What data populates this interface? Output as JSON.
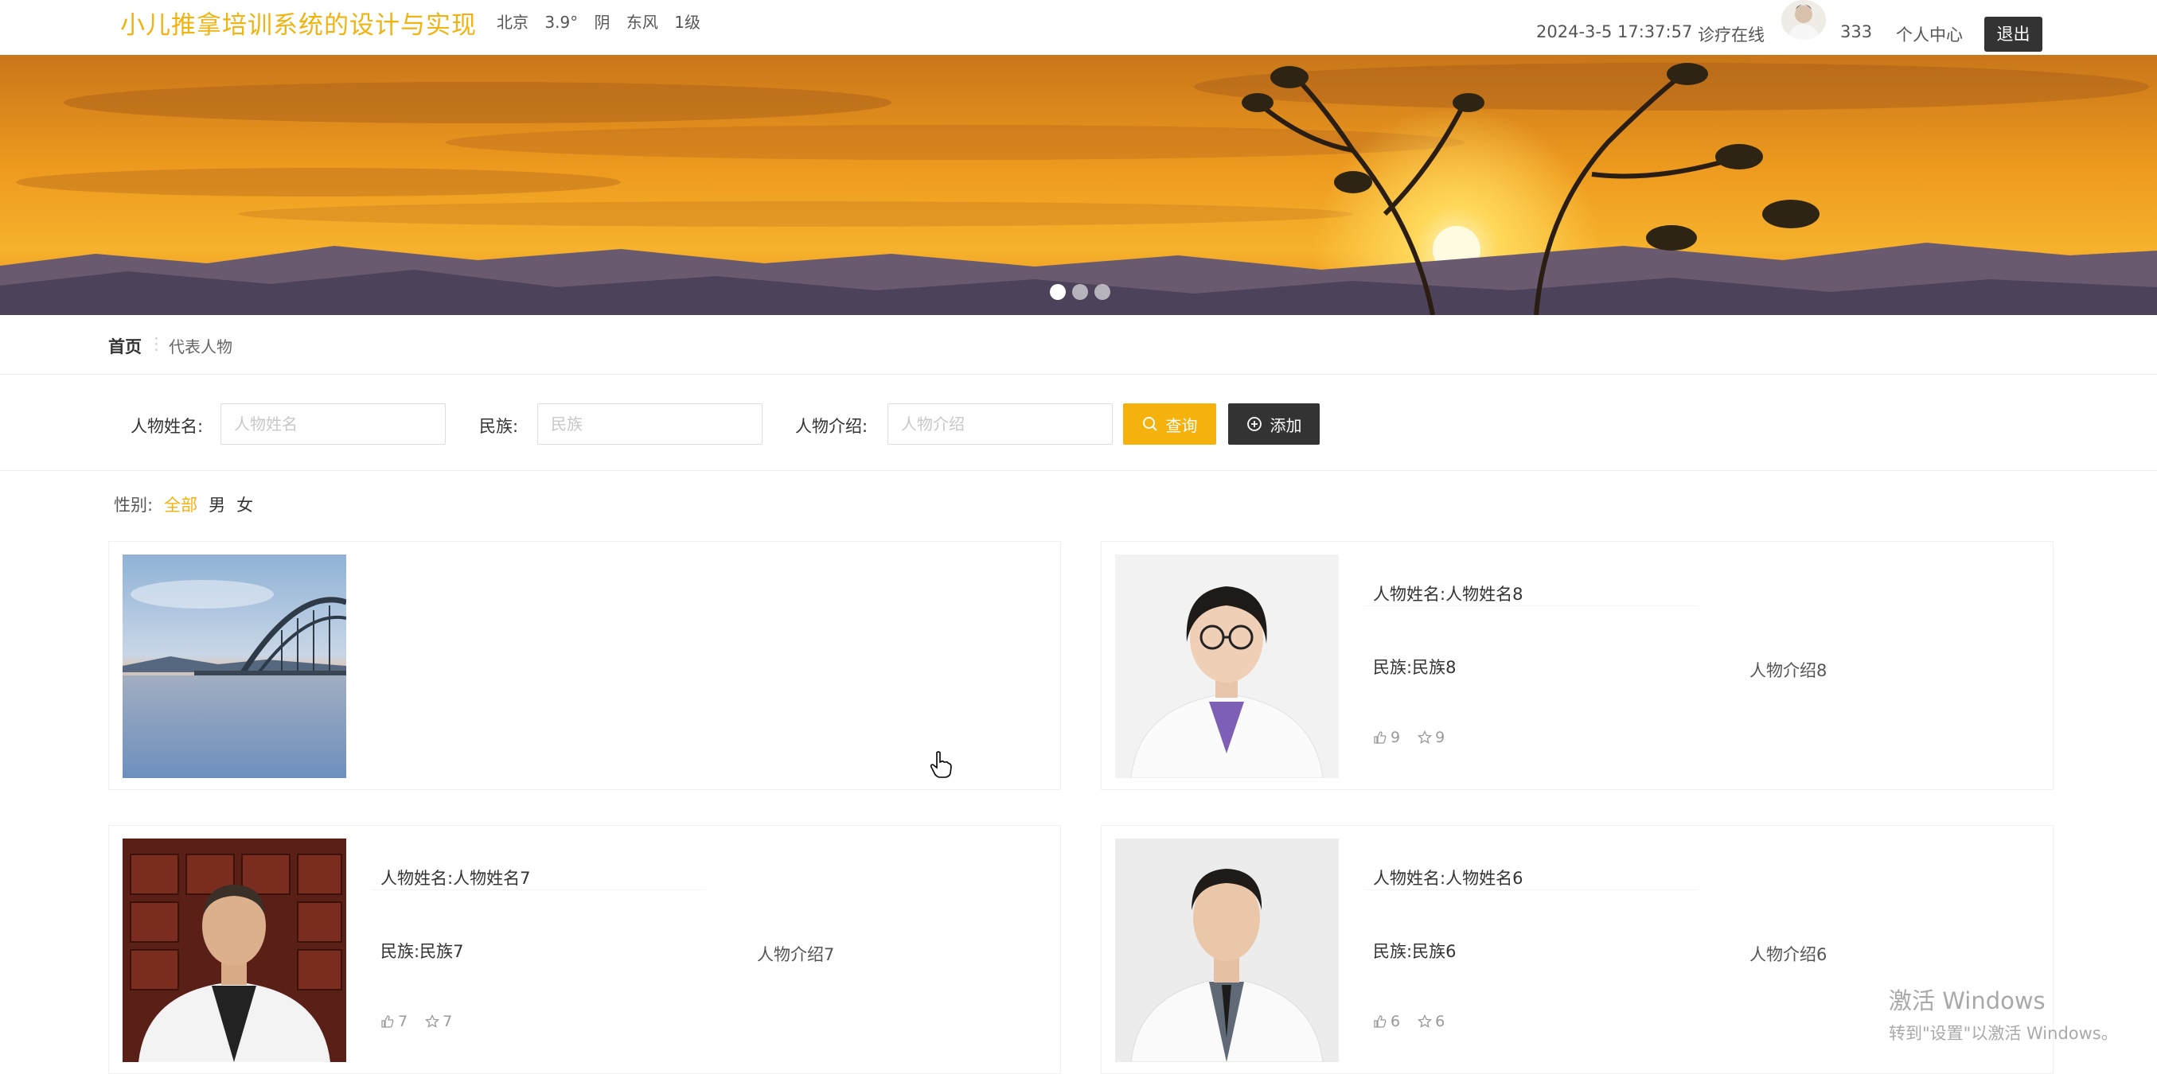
{
  "header": {
    "site_title": "小儿推拿培训系统的设计与实现",
    "weather": {
      "city": "北京",
      "temp": "3.9°",
      "condition": "阴",
      "wind": "东风",
      "level": "1级"
    },
    "datetime": "2024-3-5 17:37:57",
    "nav_link": "诊疗在线",
    "username": "333",
    "profile_link": "个人中心",
    "logout_label": "退出"
  },
  "banner": {
    "slide_count": 3,
    "active_slide": 1
  },
  "breadcrumb": {
    "home": "首页",
    "separator": "⋮",
    "current": "代表人物"
  },
  "search": {
    "name_label": "人物姓名:",
    "name_placeholder": "人物姓名",
    "nation_label": "民族:",
    "nation_placeholder": "民族",
    "intro_label": "人物介绍:",
    "intro_placeholder": "人物介绍",
    "query_label": "查询",
    "add_label": "添加"
  },
  "filter": {
    "label": "性别:",
    "options": [
      "全部",
      "男",
      "女"
    ],
    "active": "全部"
  },
  "cards": [
    {
      "name": "",
      "nation": "",
      "intro": "",
      "likes": "",
      "favorites": "",
      "image": "landscape-bridge"
    },
    {
      "name": "人物姓名:人物姓名8",
      "nation": "民族:民族8",
      "intro": "人物介绍8",
      "likes": "9",
      "favorites": "9",
      "image": "doctor-woman-glasses"
    },
    {
      "name": "人物姓名:人物姓名7",
      "nation": "民族:民族7",
      "intro": "人物介绍7",
      "likes": "7",
      "favorites": "7",
      "image": "doctor-man-cabinet"
    },
    {
      "name": "人物姓名:人物姓名6",
      "nation": "民族:民族6",
      "intro": "人物介绍6",
      "likes": "6",
      "favorites": "6",
      "image": "doctor-man-white-coat"
    }
  ],
  "watermark": {
    "line1": "激活 Windows",
    "line2": "转到\"设置\"以激活 Windows。"
  },
  "colors": {
    "accent": "#f5b10c",
    "title": "#f0b310",
    "dark_button": "#333333"
  }
}
